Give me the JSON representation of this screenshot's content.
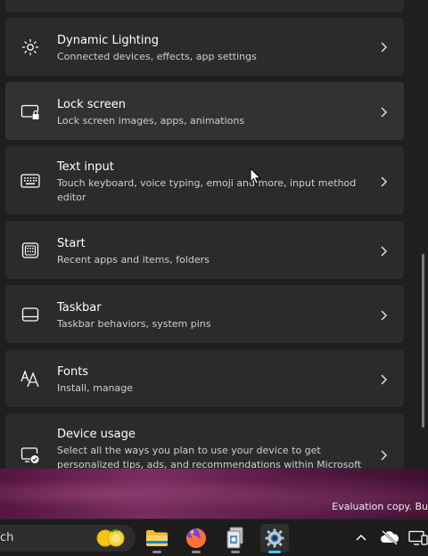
{
  "settings": {
    "items": [
      {
        "title": "Dynamic Lighting",
        "subtitle": "Connected devices, effects, app settings",
        "icon": "dynamic-lighting-icon"
      },
      {
        "title": "Lock screen",
        "subtitle": "Lock screen images, apps, animations",
        "icon": "lock-screen-icon"
      },
      {
        "title": "Text input",
        "subtitle": "Touch keyboard, voice typing, emoji and more, input method editor",
        "icon": "keyboard-icon"
      },
      {
        "title": "Start",
        "subtitle": "Recent apps and items, folders",
        "icon": "start-icon"
      },
      {
        "title": "Taskbar",
        "subtitle": "Taskbar behaviors, system pins",
        "icon": "taskbar-icon"
      },
      {
        "title": "Fonts",
        "subtitle": "Install, manage",
        "icon": "fonts-icon"
      },
      {
        "title": "Device usage",
        "subtitle": "Select all the ways you plan to use your device to get personalized tips, ads, and recommendations within Microsoft",
        "icon": "device-usage-icon"
      }
    ]
  },
  "desktop": {
    "watermark": "Evaluation copy. Bu"
  },
  "taskbar": {
    "search_text": "ch",
    "apps": [
      "file-explorer-icon",
      "firefox-icon",
      "documents-app-icon",
      "settings-app-icon"
    ],
    "tray": [
      "chevron-up-icon",
      "cloud-offline-icon",
      "display-icon"
    ]
  },
  "colors": {
    "card": "#2b2b2b",
    "background": "#1f1f1f",
    "accent": "#4cc2ff"
  }
}
